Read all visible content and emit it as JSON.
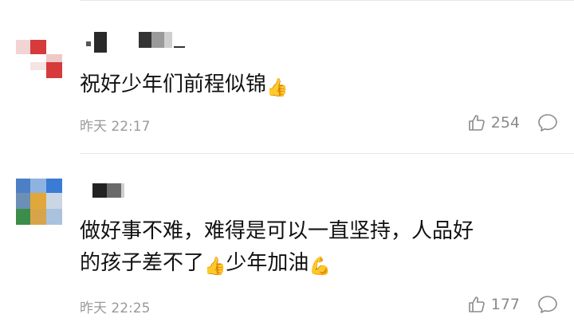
{
  "comments": [
    {
      "username": "",
      "text_lines": [
        "祝好少年们前程似锦"
      ],
      "emojis": [
        "thumbs-up"
      ],
      "time": "昨天 22:17",
      "likes": "254",
      "colors": {
        "avatar_red": "#d63a3a",
        "avatar_pink": "#f0c8c8"
      }
    },
    {
      "username": "",
      "text_lines": [
        "做好事不难，难得是可以一直坚持，人品好",
        "的孩子差不了",
        "少年加油"
      ],
      "emojis": [
        "thumbs-up",
        "flexed-biceps"
      ],
      "time": "昨天 22:25",
      "likes": "177",
      "colors": {
        "avatar_blue": "#3a7bd5",
        "avatar_green": "#3c8d4a",
        "avatar_yellow": "#e0a83a"
      }
    }
  ],
  "icons": {
    "like": "thumbs-up-outline-icon",
    "comment": "speech-bubble-icon"
  }
}
